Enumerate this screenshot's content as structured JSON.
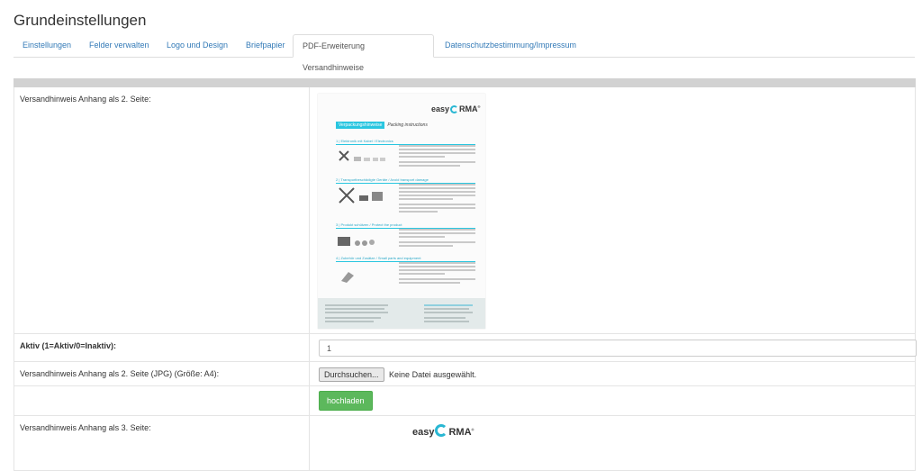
{
  "page": {
    "title": "Grundeinstellungen"
  },
  "tabs": [
    {
      "label": "Einstellungen",
      "active": false
    },
    {
      "label": "Felder verwalten",
      "active": false
    },
    {
      "label": "Logo und Design",
      "active": false
    },
    {
      "label": "Briefpapier",
      "active": false
    },
    {
      "label": "PDF-Erweiterung Versandhinweise",
      "active": true
    },
    {
      "label": "Datenschutzbestimmung/Impressum",
      "active": false
    }
  ],
  "form": {
    "page2_label": "Versandhinweis Anhang als 2. Seite:",
    "active_label": "Aktiv (1=Aktiv/0=Inaktiv):",
    "active_value": "1",
    "upload_label": "Versandhinweis Anhang als 2. Seite (JPG) (Größe: A4):",
    "browse_label": "Durchsuchen...",
    "no_file_text": "Keine Datei ausgewählt.",
    "upload_button": "hochladen",
    "page3_label": "Versandhinweis Anhang als 3. Seite:"
  },
  "preview": {
    "logo_pre": "easy",
    "logo_post": "RMA",
    "logo_mark": "®",
    "heading_highlight": "Verpackungshinweise",
    "heading_text": "Packing instructions",
    "sections": [
      "1 | Elektronik mit Kabel  /  Electronics",
      "2 | Transportbeschädigte Geräte  /  Avoid transport damage",
      "3 | Produkt schützen  /  Protect the product",
      "4 | Zubehör und Zusätze  /  Small parts and equipment"
    ]
  },
  "colors": {
    "accent": "#29c6e0",
    "link": "#337ab7",
    "success": "#5cb85c"
  }
}
